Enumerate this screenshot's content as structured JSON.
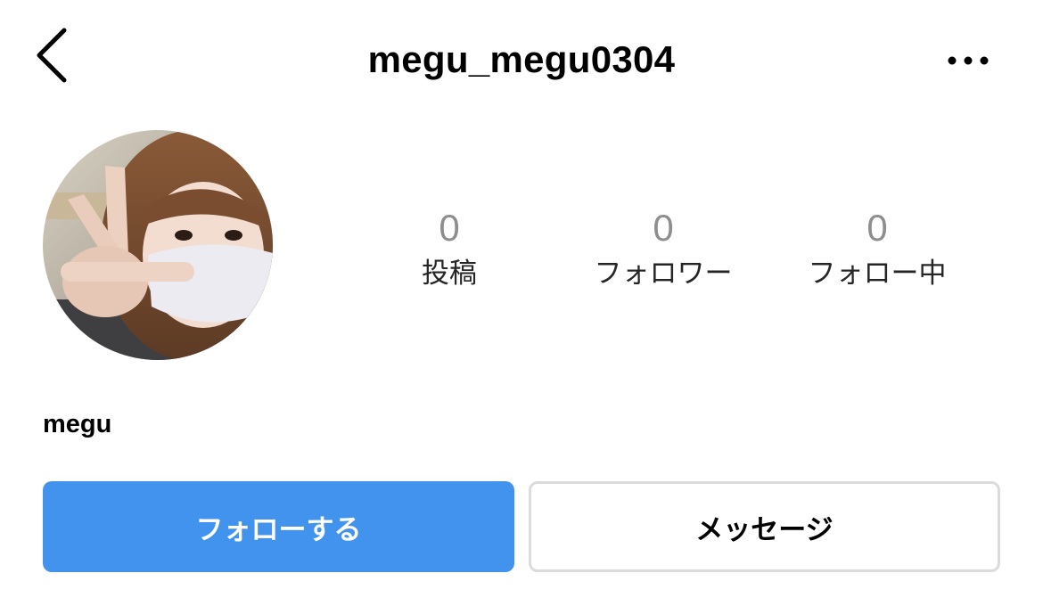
{
  "header": {
    "username": "megu_megu0304",
    "back_icon": "chevron-left-icon",
    "more_icon": "more-horizontal-icon"
  },
  "profile": {
    "avatar_icon": "profile-photo",
    "display_name": "megu",
    "stats": [
      {
        "count": "0",
        "label": "投稿"
      },
      {
        "count": "0",
        "label": "フォロワー"
      },
      {
        "count": "0",
        "label": "フォロー中"
      }
    ]
  },
  "actions": {
    "follow_label": "フォローする",
    "message_label": "メッセージ"
  },
  "colors": {
    "follow_button": "#4293ee",
    "stat_count": "#8e8e8e",
    "message_border": "#dbdbdb"
  }
}
